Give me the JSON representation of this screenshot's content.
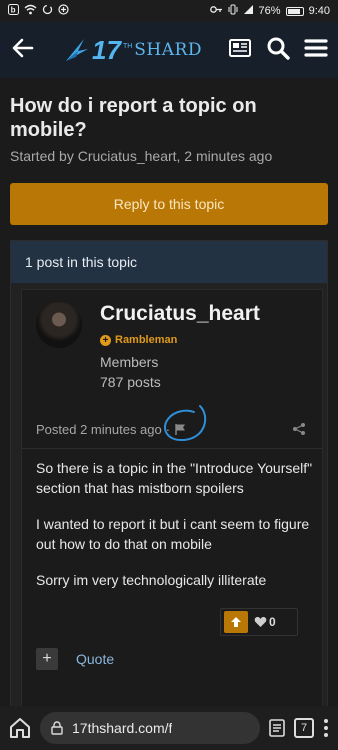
{
  "status_bar": {
    "time": "9:40",
    "battery": "76%",
    "left_icons": [
      "notification-b-icon",
      "wifi-icon",
      "sync-icon",
      "data-saver-icon"
    ],
    "right_icons": [
      "key-icon",
      "vibrate-icon",
      "signal-icon",
      "battery-icon"
    ]
  },
  "header": {
    "logo_number": "17",
    "logo_prefix_superscript": "TH",
    "logo_word": "SHARD",
    "icons": [
      "back-arrow-icon",
      "news-icon",
      "search-icon",
      "hamburger-menu-icon"
    ]
  },
  "topic": {
    "title": "How do i report a topic on mobile?",
    "started_by": "Started by Cruciatus_heart, 2 minutes ago",
    "reply_button_label": "Reply to this topic",
    "posts_count_label": "1 post in this topic"
  },
  "post": {
    "author": "Cruciatus_heart",
    "rank": "Rambleman",
    "group": "Members",
    "post_count": "787 posts",
    "posted_time": "Posted 2 minutes ago",
    "meta_separator": "·",
    "paragraphs": [
      "So there is a topic in the \"Introduce Yourself\" section that has mistborn spoilers",
      "I wanted to report it but i cant seem to figure out how to do that on mobile",
      "Sorry im very technologically illiterate"
    ],
    "reaction_count": "0",
    "quote_label": "Quote",
    "plus_label": "+"
  },
  "browser": {
    "url": "17thshard.com/f",
    "tab_count": "7"
  },
  "colors": {
    "accent_orange": "#b97806",
    "header_blue": "#233243",
    "logo_blue": "#55b5ef",
    "annotation_circle": "#2f8fd8"
  }
}
